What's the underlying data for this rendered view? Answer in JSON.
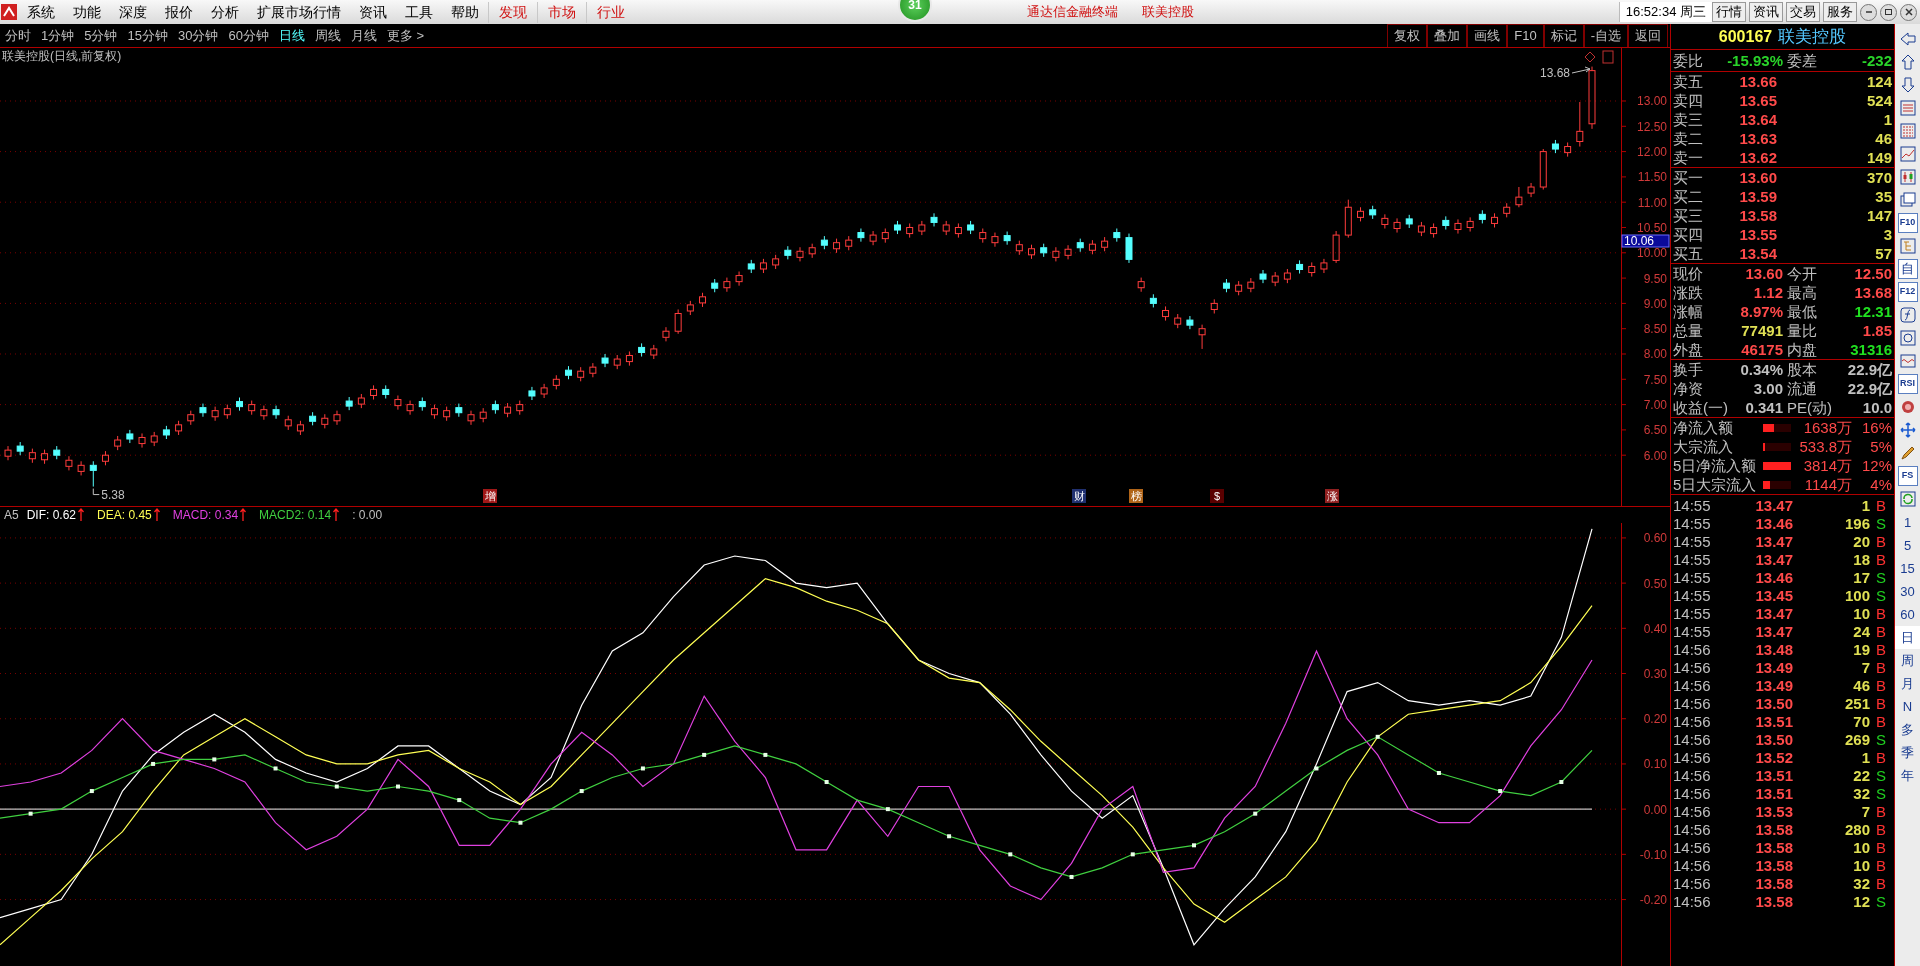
{
  "menu_bar": {
    "items": [
      {
        "label": "系统",
        "kind": "menu"
      },
      {
        "label": "功能",
        "kind": "menu"
      },
      {
        "label": "深度",
        "kind": "menu"
      },
      {
        "label": "报价",
        "kind": "menu"
      },
      {
        "label": "分析",
        "kind": "menu"
      },
      {
        "label": "扩展市场行情",
        "kind": "menu"
      },
      {
        "label": "资讯",
        "kind": "menu"
      },
      {
        "label": "工具",
        "kind": "menu"
      },
      {
        "label": "帮助",
        "kind": "menu"
      },
      {
        "label": "发现",
        "kind": "highlight"
      },
      {
        "label": "市场",
        "kind": "highlight"
      },
      {
        "label": "行业",
        "kind": "highlight"
      }
    ],
    "badge": "31",
    "app_title": "通达信金融终端",
    "stock_title": "联美控股",
    "clock": "16:52:34 周三",
    "buttons": [
      "行情",
      "资讯",
      "交易",
      "服务"
    ]
  },
  "period_tabs": [
    {
      "label": "分时",
      "selected": false
    },
    {
      "label": "1分钟",
      "selected": false
    },
    {
      "label": "5分钟",
      "selected": false
    },
    {
      "label": "15分钟",
      "selected": false
    },
    {
      "label": "30分钟",
      "selected": false
    },
    {
      "label": "60分钟",
      "selected": false
    },
    {
      "label": "日线",
      "selected": true
    },
    {
      "label": "周线",
      "selected": false
    },
    {
      "label": "月线",
      "selected": false
    },
    {
      "label": "更多 >",
      "selected": false
    }
  ],
  "chart_tools": [
    "复权",
    "叠加",
    "画线",
    "F10",
    "标记",
    "-自选",
    "返回"
  ],
  "price_chart": {
    "title": "联美控股(日线,前复权)",
    "high_label": "13.68",
    "low_label": "5.38",
    "price_tag": "10.06",
    "chart_data": {
      "type": "candlestick",
      "grid": true,
      "ylim": [
        4.996,
        14.067
      ],
      "yticks": [
        {
          "value": 13,
          "label": "13.00"
        },
        {
          "value": 12.5,
          "label": "12.50"
        },
        {
          "value": 12,
          "label": "12.00"
        },
        {
          "value": 11.5,
          "label": "11.50"
        },
        {
          "value": 11,
          "label": "11.00"
        },
        {
          "value": 10.5,
          "label": "10.50"
        },
        {
          "value": 10,
          "label": "10.00"
        },
        {
          "value": 9.5,
          "label": "9.50"
        },
        {
          "value": 9,
          "label": "9.00"
        },
        {
          "value": 8.5,
          "label": "8.50"
        },
        {
          "value": 8,
          "label": "8.00"
        },
        {
          "value": 7.5,
          "label": "7.50"
        },
        {
          "value": 7,
          "label": "7.00"
        },
        {
          "value": 6.5,
          "label": "6.50"
        },
        {
          "value": 6,
          "label": "6.00"
        }
      ],
      "ohlc": [
        [
          5.98,
          6.18,
          5.9,
          6.1
        ],
        [
          6.18,
          6.26,
          6.0,
          6.08
        ],
        [
          5.93,
          6.13,
          5.85,
          6.05
        ],
        [
          5.91,
          6.11,
          5.83,
          6.03
        ],
        [
          6.1,
          6.18,
          5.92,
          6.0
        ],
        [
          5.78,
          5.98,
          5.7,
          5.9
        ],
        [
          5.68,
          5.88,
          5.6,
          5.8
        ],
        [
          5.8,
          5.88,
          5.38,
          5.7
        ],
        [
          5.88,
          6.08,
          5.8,
          6.0
        ],
        [
          6.18,
          6.38,
          6.1,
          6.3
        ],
        [
          6.42,
          6.5,
          6.24,
          6.32
        ],
        [
          6.23,
          6.43,
          6.15,
          6.35
        ],
        [
          6.26,
          6.46,
          6.18,
          6.38
        ],
        [
          6.5,
          6.58,
          6.32,
          6.4
        ],
        [
          6.48,
          6.68,
          6.4,
          6.6
        ],
        [
          6.68,
          6.88,
          6.6,
          6.8
        ],
        [
          6.94,
          7.02,
          6.76,
          6.84
        ],
        [
          6.76,
          6.96,
          6.68,
          6.88
        ],
        [
          6.8,
          7.0,
          6.72,
          6.92
        ],
        [
          7.06,
          7.14,
          6.88,
          6.96
        ],
        [
          6.88,
          7.08,
          6.8,
          7.0
        ],
        [
          6.78,
          6.98,
          6.7,
          6.9
        ],
        [
          6.9,
          6.98,
          6.72,
          6.8
        ],
        [
          6.58,
          6.78,
          6.5,
          6.7
        ],
        [
          6.48,
          6.68,
          6.4,
          6.6
        ],
        [
          6.77,
          6.85,
          6.59,
          6.67
        ],
        [
          6.61,
          6.81,
          6.53,
          6.73
        ],
        [
          6.68,
          6.88,
          6.6,
          6.8
        ],
        [
          7.07,
          7.15,
          6.89,
          6.97
        ],
        [
          7.01,
          7.21,
          6.93,
          7.13
        ],
        [
          7.18,
          7.38,
          7.1,
          7.3
        ],
        [
          7.3,
          7.38,
          7.12,
          7.2
        ],
        [
          6.98,
          7.18,
          6.9,
          7.1
        ],
        [
          6.88,
          7.08,
          6.8,
          7.0
        ],
        [
          7.06,
          7.14,
          6.88,
          6.96
        ],
        [
          6.8,
          7.0,
          6.72,
          6.92
        ],
        [
          6.76,
          6.96,
          6.68,
          6.88
        ],
        [
          6.94,
          7.02,
          6.76,
          6.84
        ],
        [
          6.68,
          6.88,
          6.6,
          6.8
        ],
        [
          6.73,
          6.93,
          6.65,
          6.85
        ],
        [
          7.0,
          7.08,
          6.82,
          6.9
        ],
        [
          6.83,
          7.03,
          6.75,
          6.95
        ],
        [
          6.88,
          7.08,
          6.8,
          7.0
        ],
        [
          7.27,
          7.35,
          7.09,
          7.17
        ],
        [
          7.21,
          7.41,
          7.13,
          7.33
        ],
        [
          7.38,
          7.58,
          7.3,
          7.5
        ],
        [
          7.68,
          7.76,
          7.5,
          7.58
        ],
        [
          7.54,
          7.74,
          7.46,
          7.66
        ],
        [
          7.62,
          7.82,
          7.54,
          7.74
        ],
        [
          7.92,
          8.0,
          7.74,
          7.82
        ],
        [
          7.78,
          7.98,
          7.7,
          7.9
        ],
        [
          7.85,
          8.05,
          7.77,
          7.97
        ],
        [
          8.13,
          8.21,
          7.95,
          8.03
        ],
        [
          7.98,
          8.18,
          7.9,
          8.1
        ],
        [
          8.33,
          8.53,
          8.25,
          8.45
        ],
        [
          8.45,
          8.88,
          8.4,
          8.8
        ],
        [
          8.85,
          9.05,
          8.77,
          8.97
        ],
        [
          9.01,
          9.21,
          8.93,
          9.13
        ],
        [
          9.4,
          9.48,
          9.22,
          9.3
        ],
        [
          9.31,
          9.51,
          9.23,
          9.43
        ],
        [
          9.43,
          9.63,
          9.35,
          9.55
        ],
        [
          9.78,
          9.86,
          9.6,
          9.68
        ],
        [
          9.68,
          9.88,
          9.6,
          9.8
        ],
        [
          9.76,
          9.96,
          9.68,
          9.88
        ],
        [
          10.05,
          10.13,
          9.87,
          9.95
        ],
        [
          9.91,
          10.11,
          9.83,
          10.03
        ],
        [
          9.98,
          10.18,
          9.9,
          10.1
        ],
        [
          10.25,
          10.33,
          10.07,
          10.15
        ],
        [
          10.08,
          10.28,
          10.0,
          10.2
        ],
        [
          10.13,
          10.33,
          10.05,
          10.25
        ],
        [
          10.4,
          10.48,
          10.22,
          10.3
        ],
        [
          10.23,
          10.43,
          10.15,
          10.35
        ],
        [
          10.28,
          10.48,
          10.2,
          10.4
        ],
        [
          10.55,
          10.63,
          10.37,
          10.45
        ],
        [
          10.38,
          10.58,
          10.3,
          10.5
        ],
        [
          10.43,
          10.63,
          10.35,
          10.55
        ],
        [
          10.7,
          10.78,
          10.52,
          10.6
        ],
        [
          10.43,
          10.63,
          10.35,
          10.55
        ],
        [
          10.38,
          10.58,
          10.3,
          10.5
        ],
        [
          10.55,
          10.63,
          10.37,
          10.45
        ],
        [
          10.28,
          10.48,
          10.2,
          10.4
        ],
        [
          10.2,
          10.4,
          10.12,
          10.32
        ],
        [
          10.34,
          10.42,
          10.16,
          10.24
        ],
        [
          10.04,
          10.24,
          9.96,
          10.16
        ],
        [
          9.96,
          10.16,
          9.88,
          10.08
        ],
        [
          10.1,
          10.18,
          9.92,
          10.0
        ],
        [
          9.91,
          10.11,
          9.83,
          10.03
        ],
        [
          9.95,
          10.15,
          9.87,
          10.07
        ],
        [
          10.2,
          10.28,
          10.02,
          10.1
        ],
        [
          10.05,
          10.25,
          9.97,
          10.17
        ],
        [
          10.11,
          10.31,
          10.03,
          10.23
        ],
        [
          10.4,
          10.48,
          10.22,
          10.3
        ],
        [
          10.3,
          10.38,
          9.8,
          9.87
        ],
        [
          9.31,
          9.51,
          9.23,
          9.43
        ],
        [
          9.1,
          9.18,
          8.92,
          9.0
        ],
        [
          8.74,
          8.94,
          8.66,
          8.86
        ],
        [
          8.59,
          8.79,
          8.51,
          8.71
        ],
        [
          8.67,
          8.75,
          8.49,
          8.57
        ],
        [
          8.38,
          8.58,
          8.1,
          8.5
        ],
        [
          8.88,
          9.08,
          8.8,
          9.0
        ],
        [
          9.4,
          9.48,
          9.22,
          9.3
        ],
        [
          9.24,
          9.44,
          9.16,
          9.36
        ],
        [
          9.3,
          9.5,
          9.22,
          9.42
        ],
        [
          9.58,
          9.66,
          9.4,
          9.48
        ],
        [
          9.42,
          9.62,
          9.34,
          9.54
        ],
        [
          9.48,
          9.68,
          9.4,
          9.6
        ],
        [
          9.77,
          9.85,
          9.59,
          9.67
        ],
        [
          9.61,
          9.81,
          9.53,
          9.73
        ],
        [
          9.68,
          9.88,
          9.6,
          9.8
        ],
        [
          9.85,
          10.43,
          9.8,
          10.35
        ],
        [
          10.35,
          11.05,
          10.3,
          10.9
        ],
        [
          10.7,
          10.9,
          10.62,
          10.82
        ],
        [
          10.85,
          10.93,
          10.67,
          10.75
        ],
        [
          10.56,
          10.76,
          10.48,
          10.68
        ],
        [
          10.48,
          10.68,
          10.4,
          10.6
        ],
        [
          10.67,
          10.75,
          10.49,
          10.57
        ],
        [
          10.41,
          10.61,
          10.33,
          10.53
        ],
        [
          10.38,
          10.58,
          10.3,
          10.5
        ],
        [
          10.64,
          10.72,
          10.46,
          10.54
        ],
        [
          10.46,
          10.66,
          10.38,
          10.58
        ],
        [
          10.5,
          10.7,
          10.42,
          10.62
        ],
        [
          10.76,
          10.84,
          10.58,
          10.66
        ],
        [
          10.58,
          10.78,
          10.5,
          10.7
        ],
        [
          10.78,
          10.98,
          10.7,
          10.9
        ],
        [
          10.95,
          11.3,
          10.9,
          11.1
        ],
        [
          11.18,
          11.38,
          11.1,
          11.3
        ],
        [
          11.3,
          12.05,
          11.25,
          12.0
        ],
        [
          12.15,
          12.23,
          11.97,
          12.05
        ],
        [
          11.98,
          12.18,
          11.9,
          12.1
        ],
        [
          12.2,
          12.98,
          12.1,
          12.4
        ],
        [
          12.55,
          13.68,
          12.45,
          13.6
        ]
      ]
    },
    "events": [
      {
        "label": "增",
        "color": "#a01818"
      },
      {
        "label": "财",
        "color": "#203070"
      },
      {
        "label": "榜",
        "color": "#b06418"
      },
      {
        "label": "$",
        "color": "#5a0000"
      },
      {
        "label": "涨",
        "color": "#902020"
      }
    ]
  },
  "indicator": {
    "name": "A5",
    "series": [
      {
        "label": "DIF: 0.62",
        "color": "#ffffff",
        "rising": true
      },
      {
        "label": "DEA: 0.45",
        "color": "#ffff54",
        "rising": true
      },
      {
        "label": "MACD: 0.34",
        "color": "#e040e0",
        "rising": true
      },
      {
        "label": "MACD2: 0.14",
        "color": "#40d040",
        "rising": true
      },
      {
        "label": ": 0.00",
        "color": "#c0c0c0",
        "rising": false
      }
    ],
    "chart_data": {
      "type": "line",
      "grid": true,
      "ylim": [
        -0.347,
        0.633
      ],
      "yticks": [
        {
          "value": 0.6,
          "label": "0.60"
        },
        {
          "value": 0.5,
          "label": "0.50"
        },
        {
          "value": 0.4,
          "label": "0.40"
        },
        {
          "value": 0.3,
          "label": "0.30"
        },
        {
          "value": 0.2,
          "label": "0.20"
        },
        {
          "value": 0.1,
          "label": "0.10"
        },
        {
          "value": 0,
          "label": "0.00"
        },
        {
          "value": -0.1,
          "label": "-0.10"
        },
        {
          "value": -0.2,
          "label": "-0.20"
        }
      ],
      "series": [
        {
          "color": "#ffffff",
          "values": [
            -0.24,
            -0.22,
            -0.2,
            -0.1,
            0.04,
            0.12,
            0.17,
            0.21,
            0.17,
            0.11,
            0.08,
            0.06,
            0.09,
            0.14,
            0.14,
            0.09,
            0.04,
            0.01,
            0.07,
            0.23,
            0.35,
            0.39,
            0.47,
            0.54,
            0.56,
            0.55,
            0.5,
            0.49,
            0.5,
            0.41,
            0.33,
            0.3,
            0.28,
            0.21,
            0.12,
            0.04,
            -0.02,
            0.03,
            -0.13,
            -0.3,
            -0.22,
            -0.15,
            -0.05,
            0.1,
            0.26,
            0.28,
            0.24,
            0.23,
            0.24,
            0.23,
            0.25,
            0.38,
            0.62
          ]
        },
        {
          "color": "#ffff54",
          "values": [
            -0.3,
            -0.24,
            -0.18,
            -0.11,
            -0.05,
            0.04,
            0.12,
            0.16,
            0.2,
            0.16,
            0.12,
            0.1,
            0.1,
            0.12,
            0.13,
            0.09,
            0.06,
            0.01,
            0.05,
            0.12,
            0.19,
            0.26,
            0.33,
            0.39,
            0.45,
            0.51,
            0.49,
            0.46,
            0.44,
            0.41,
            0.33,
            0.29,
            0.28,
            0.22,
            0.15,
            0.09,
            0.03,
            -0.04,
            -0.13,
            -0.21,
            -0.25,
            -0.2,
            -0.15,
            -0.07,
            0.06,
            0.16,
            0.21,
            0.22,
            0.23,
            0.24,
            0.28,
            0.36,
            0.45
          ]
        },
        {
          "color": "#e040e0",
          "values": [
            0.05,
            0.06,
            0.08,
            0.13,
            0.2,
            0.13,
            0.11,
            0.09,
            0.06,
            -0.03,
            -0.09,
            -0.06,
            0.0,
            0.11,
            0.05,
            -0.08,
            -0.08,
            0.0,
            0.1,
            0.17,
            0.12,
            0.05,
            0.1,
            0.25,
            0.15,
            0.07,
            -0.09,
            -0.09,
            0.02,
            -0.06,
            0.05,
            0.05,
            -0.09,
            -0.17,
            -0.2,
            -0.12,
            0.0,
            0.05,
            -0.14,
            -0.13,
            -0.02,
            0.05,
            0.19,
            0.35,
            0.2,
            0.12,
            0.0,
            -0.03,
            -0.03,
            0.03,
            0.14,
            0.22,
            0.33
          ]
        },
        {
          "color": "#40d040",
          "values": [
            -0.02,
            -0.01,
            0.0,
            0.04,
            0.07,
            0.1,
            0.11,
            0.11,
            0.12,
            0.09,
            0.06,
            0.05,
            0.04,
            0.05,
            0.04,
            0.02,
            -0.02,
            -0.03,
            0.0,
            0.04,
            0.07,
            0.09,
            0.1,
            0.12,
            0.14,
            0.12,
            0.1,
            0.06,
            0.02,
            0.0,
            -0.03,
            -0.06,
            -0.08,
            -0.1,
            -0.13,
            -0.15,
            -0.13,
            -0.1,
            -0.09,
            -0.08,
            -0.05,
            -0.01,
            0.04,
            0.09,
            0.13,
            0.16,
            0.12,
            0.08,
            0.06,
            0.04,
            0.03,
            0.06,
            0.13
          ]
        }
      ]
    }
  },
  "quote_panel": {
    "code": "600167",
    "name": "联美控股",
    "order_ratio": [
      {
        "label": "委比",
        "value": "-15.93%"
      },
      {
        "label": "委差",
        "value": "-232"
      }
    ],
    "asks": [
      {
        "label": "卖五",
        "price": "13.66",
        "volume": "124"
      },
      {
        "label": "卖四",
        "price": "13.65",
        "volume": "524"
      },
      {
        "label": "卖三",
        "price": "13.64",
        "volume": "1"
      },
      {
        "label": "卖二",
        "price": "13.63",
        "volume": "46"
      },
      {
        "label": "卖一",
        "price": "13.62",
        "volume": "149"
      }
    ],
    "bids": [
      {
        "label": "买一",
        "price": "13.60",
        "volume": "370"
      },
      {
        "label": "买二",
        "price": "13.59",
        "volume": "35"
      },
      {
        "label": "买三",
        "price": "13.58",
        "volume": "147"
      },
      {
        "label": "买四",
        "price": "13.55",
        "volume": "3"
      },
      {
        "label": "买五",
        "price": "13.54",
        "volume": "57"
      }
    ],
    "stats": [
      {
        "label": "现价",
        "value": "13.60",
        "color": "#ff4a4a"
      },
      {
        "label": "今开",
        "value": "12.50",
        "color": "#ff4a4a"
      },
      {
        "label": "涨跌",
        "value": "1.12",
        "color": "#ff4a4a"
      },
      {
        "label": "最高",
        "value": "13.68",
        "color": "#ff4a4a"
      },
      {
        "label": "涨幅",
        "value": "8.97%",
        "color": "#ff4a4a"
      },
      {
        "label": "最低",
        "value": "12.31",
        "color": "#20e020"
      },
      {
        "label": "总量",
        "value": "77491",
        "color": "#e0e054"
      },
      {
        "label": "量比",
        "value": "1.85",
        "color": "#ff4a4a"
      },
      {
        "label": "外盘",
        "value": "46175",
        "color": "#ff4a4a"
      },
      {
        "label": "内盘",
        "value": "31316",
        "color": "#20e020"
      }
    ],
    "fundamentals": [
      {
        "label": "换手",
        "value": "0.34%"
      },
      {
        "label": "股本",
        "value": "22.9亿"
      },
      {
        "label": "净资",
        "value": "3.00"
      },
      {
        "label": "流通",
        "value": "22.9亿"
      },
      {
        "label": "收益(一)",
        "value": "0.341"
      },
      {
        "label": "PE(动)",
        "value": "10.0"
      }
    ],
    "fund_flows": [
      {
        "label": "净流入额",
        "level": 0.4,
        "amount": "1638万",
        "percent": "16%"
      },
      {
        "label": "大宗流入",
        "level": 0.08,
        "amount": "533.8万",
        "percent": "5%"
      },
      {
        "label": "5日净流入额",
        "level": 1.0,
        "amount": "3814万",
        "percent": "12%"
      },
      {
        "label": "5日大宗流入",
        "level": 0.25,
        "amount": "1144万",
        "percent": "4%"
      }
    ]
  },
  "ticks": [
    {
      "time": "14:55",
      "price": "13.47",
      "volume": "1",
      "side": "B",
      "kind": "buy"
    },
    {
      "time": "14:55",
      "price": "13.46",
      "volume": "196",
      "side": "S",
      "kind": "sell"
    },
    {
      "time": "14:55",
      "price": "13.47",
      "volume": "20",
      "side": "B",
      "kind": "buy"
    },
    {
      "time": "14:55",
      "price": "13.47",
      "volume": "18",
      "side": "B",
      "kind": "buy"
    },
    {
      "time": "14:55",
      "price": "13.46",
      "volume": "17",
      "side": "S",
      "kind": "sell"
    },
    {
      "time": "14:55",
      "price": "13.45",
      "volume": "100",
      "side": "S",
      "kind": "sell"
    },
    {
      "time": "14:55",
      "price": "13.47",
      "volume": "10",
      "side": "B",
      "kind": "buy"
    },
    {
      "time": "14:55",
      "price": "13.47",
      "volume": "24",
      "side": "B",
      "kind": "buy"
    },
    {
      "time": "14:56",
      "price": "13.48",
      "volume": "19",
      "side": "B",
      "kind": "buy"
    },
    {
      "time": "14:56",
      "price": "13.49",
      "volume": "7",
      "side": "B",
      "kind": "buy"
    },
    {
      "time": "14:56",
      "price": "13.49",
      "volume": "46",
      "side": "B",
      "kind": "buy"
    },
    {
      "time": "14:56",
      "price": "13.50",
      "volume": "251",
      "side": "B",
      "kind": "buy"
    },
    {
      "time": "14:56",
      "price": "13.51",
      "volume": "70",
      "side": "B",
      "kind": "buy"
    },
    {
      "time": "14:56",
      "price": "13.50",
      "volume": "269",
      "side": "S",
      "kind": "sell"
    },
    {
      "time": "14:56",
      "price": "13.52",
      "volume": "1",
      "side": "B",
      "kind": "buy"
    },
    {
      "time": "14:56",
      "price": "13.51",
      "volume": "22",
      "side": "S",
      "kind": "sell"
    },
    {
      "time": "14:56",
      "price": "13.51",
      "volume": "32",
      "side": "S",
      "kind": "sell"
    },
    {
      "time": "14:56",
      "price": "13.53",
      "volume": "7",
      "side": "B",
      "kind": "buy"
    },
    {
      "time": "14:56",
      "price": "13.58",
      "volume": "280",
      "side": "B",
      "kind": "buy"
    },
    {
      "time": "14:56",
      "price": "13.58",
      "volume": "10",
      "side": "B",
      "kind": "buy"
    },
    {
      "time": "14:56",
      "price": "13.58",
      "volume": "10",
      "side": "B",
      "kind": "buy"
    },
    {
      "time": "14:56",
      "price": "13.58",
      "volume": "32",
      "side": "B",
      "kind": "buy"
    },
    {
      "time": "14:56",
      "price": "13.58",
      "volume": "12",
      "side": "S",
      "kind": "sell"
    }
  ],
  "side_toolbar": {
    "labels": [
      "F10",
      "自",
      "F12",
      "RSI",
      "FS"
    ],
    "periods": [
      {
        "label": "1",
        "selected": false
      },
      {
        "label": "5",
        "selected": false
      },
      {
        "label": "15",
        "selected": false
      },
      {
        "label": "30",
        "selected": false
      },
      {
        "label": "60",
        "selected": false
      },
      {
        "label": "日",
        "selected": true
      },
      {
        "label": "周",
        "selected": false
      },
      {
        "label": "月",
        "selected": false
      },
      {
        "label": "N",
        "selected": false
      },
      {
        "label": "多",
        "selected": false
      },
      {
        "label": "季",
        "selected": false
      },
      {
        "label": "年",
        "selected": false
      }
    ]
  }
}
